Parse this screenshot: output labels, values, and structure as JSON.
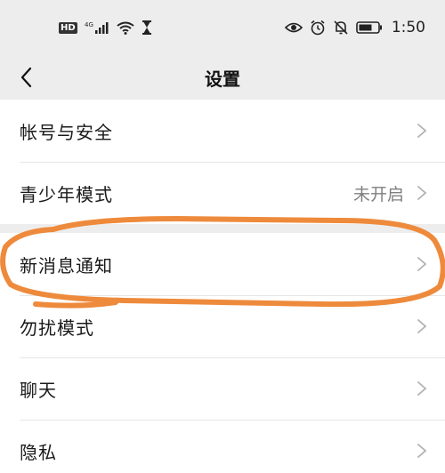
{
  "status_bar": {
    "hd": "HD",
    "network": "4G",
    "time": "1:50",
    "icons": [
      "hd-icon",
      "signal-icon",
      "wifi-icon",
      "hourglass-icon",
      "eye-icon",
      "alarm-icon",
      "mute-bell-icon",
      "battery-icon"
    ]
  },
  "navbar": {
    "title": "设置",
    "back_icon": "chevron-left-icon"
  },
  "settings": {
    "account_security": "帐号与安全",
    "teen_mode": "青少年模式",
    "teen_mode_value": "未开启",
    "new_message_notification": "新消息通知",
    "do_not_disturb": "勿扰模式",
    "chat": "聊天",
    "privacy": "隐私"
  },
  "annotation": {
    "color": "#ee8a3c",
    "target": "新消息通知"
  },
  "colors": {
    "background": "#ededed",
    "card": "#ffffff",
    "secondary_text": "#7f7f7f",
    "chevron": "#b2b2b2"
  }
}
